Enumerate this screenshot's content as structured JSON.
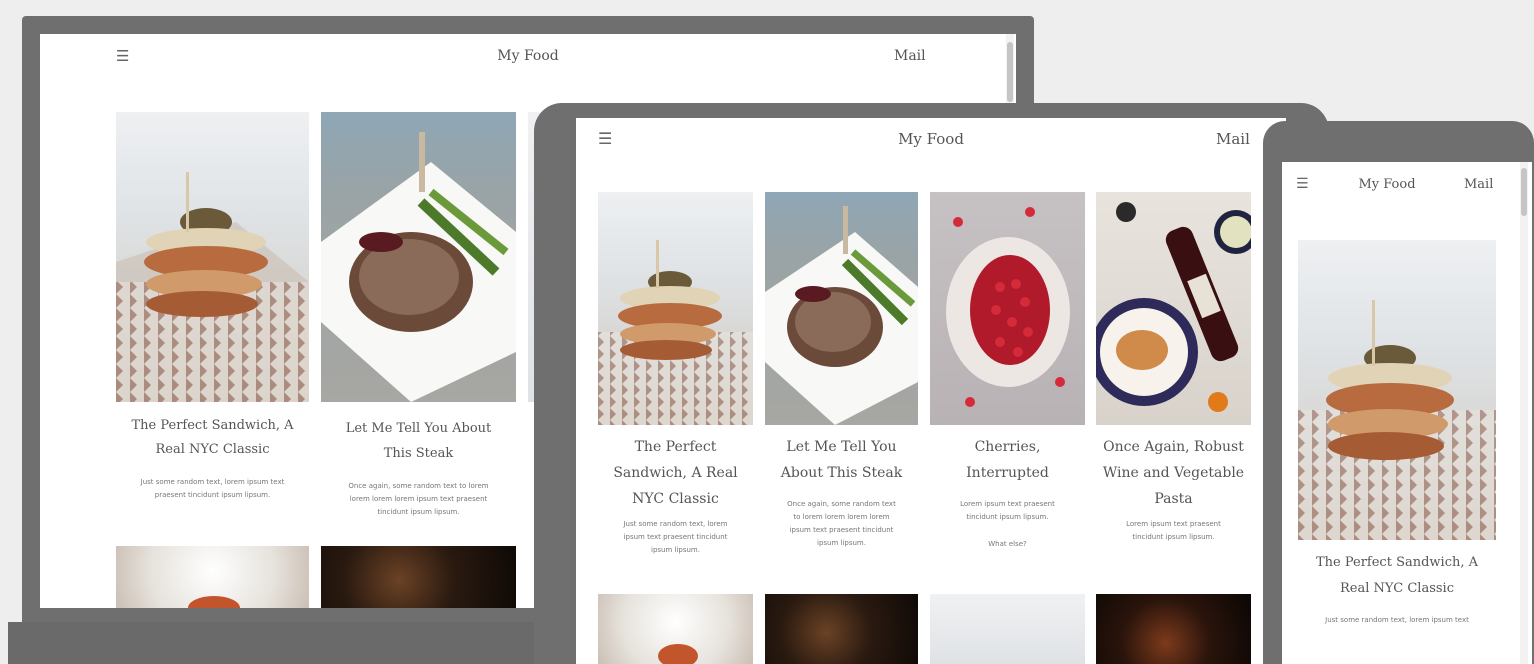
{
  "site": {
    "brand": "My Food",
    "menu_icon": "hamburger-icon",
    "mail_label": "Mail"
  },
  "desktop": {
    "posts": [
      {
        "title_lines": [
          "The Perfect Sandwich, A",
          "Real NYC Classic"
        ],
        "excerpt_lines": [
          "Just some random text, lorem ipsum text",
          "praesent tincidunt ipsum lipsum."
        ]
      },
      {
        "title_lines": [
          "Let Me Tell You About",
          "This Steak"
        ],
        "excerpt_lines": [
          "Once again, some random text to lorem",
          "lorem lorem lorem ipsum text praesent",
          "tincidunt ipsum lipsum."
        ]
      }
    ]
  },
  "tablet": {
    "posts": [
      {
        "title_lines": [
          "The Perfect",
          "Sandwich, A Real",
          "NYC Classic"
        ],
        "excerpt_lines": [
          "Just some random text, lorem",
          "ipsum text praesent tincidunt",
          "ipsum lipsum."
        ]
      },
      {
        "title_lines": [
          "Let Me Tell You",
          "About This Steak"
        ],
        "excerpt_lines": [
          "Once again, some random text",
          "to lorem lorem lorem lorem",
          "ipsum text praesent tincidunt",
          "ipsum lipsum."
        ]
      },
      {
        "title_lines": [
          "Cherries,",
          "Interrupted"
        ],
        "excerpt_lines": [
          "Lorem ipsum text praesent",
          "tincidunt ipsum lipsum."
        ],
        "more": "What else?"
      },
      {
        "title_lines": [
          "Once Again, Robust",
          "Wine and Vegetable",
          "Pasta"
        ],
        "excerpt_lines": [
          "Lorem ipsum text praesent",
          "tincidunt ipsum lipsum."
        ]
      }
    ]
  },
  "phone": {
    "posts": [
      {
        "title_lines": [
          "The Perfect Sandwich, A",
          "Real NYC Classic"
        ],
        "excerpt_lines": [
          "Just some random text, lorem ipsum text"
        ]
      }
    ]
  }
}
